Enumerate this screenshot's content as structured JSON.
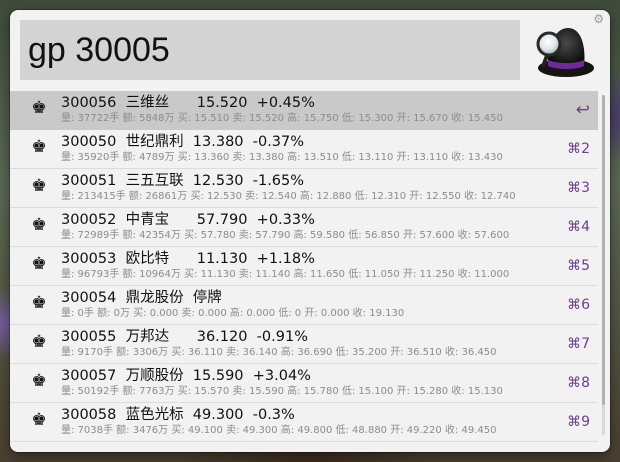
{
  "search": {
    "query": "gp 30005"
  },
  "app": {
    "settings_icon": "gear-icon",
    "logo_icon": "alfred-hat-icon"
  },
  "results": [
    {
      "icon": "chess-king-icon",
      "title": "300056  三维丝      15.520  +0.45%",
      "subtitle": "量: 37722手 额: 5848万 买: 15.510 卖: 15.520 高: 15.750 低: 15.300 开: 15.670 收: 15.450",
      "shortcut": "↩",
      "selected": true
    },
    {
      "icon": "chess-king-icon",
      "title": "300050  世纪鼎利  13.380  -0.37%",
      "subtitle": "量: 35920手 额: 4789万 买: 13.360 卖: 13.380 高: 13.510 低: 13.110 开: 13.110 收: 13.430",
      "shortcut": "⌘2",
      "selected": false
    },
    {
      "icon": "chess-king-icon",
      "title": "300051  三五互联  12.530  -1.65%",
      "subtitle": "量: 213415手 额: 26861万 买: 12.530 卖: 12.540 高: 12.880 低: 12.310 开: 12.550 收: 12.740",
      "shortcut": "⌘3",
      "selected": false
    },
    {
      "icon": "chess-king-icon",
      "title": "300052  中青宝      57.790  +0.33%",
      "subtitle": "量: 72989手 额: 42354万 买: 57.780 卖: 57.790 高: 59.580 低: 56.850 开: 57.600 收: 57.600",
      "shortcut": "⌘4",
      "selected": false
    },
    {
      "icon": "chess-king-icon",
      "title": "300053  欧比特      11.130  +1.18%",
      "subtitle": "量: 96793手 额: 10964万 买: 11.130 卖: 11.140 高: 11.650 低: 11.050 开: 11.250 收: 11.000",
      "shortcut": "⌘5",
      "selected": false
    },
    {
      "icon": "chess-king-icon",
      "title": "300054  鼎龙股份  停牌",
      "subtitle": "量: 0手 额: 0万 买: 0.000 卖: 0.000 高: 0.000 低: 0 开: 0.000 收: 19.130",
      "shortcut": "⌘6",
      "selected": false
    },
    {
      "icon": "chess-king-icon",
      "title": "300055  万邦达      36.120  -0.91%",
      "subtitle": "量: 9170手 额: 3306万 买: 36.110 卖: 36.140 高: 36.690 低: 35.200 开: 36.510 收: 36.450",
      "shortcut": "⌘7",
      "selected": false
    },
    {
      "icon": "chess-king-icon",
      "title": "300057  万顺股份  15.590  +3.04%",
      "subtitle": "量: 50192手 额: 7763万 买: 15.570 卖: 15.590 高: 15.780 低: 15.100 开: 15.280 收: 15.130",
      "shortcut": "⌘8",
      "selected": false
    },
    {
      "icon": "chess-king-icon",
      "title": "300058  蓝色光标  49.300  -0.3%",
      "subtitle": "量: 7038手 额: 3476万 买: 49.100 卖: 49.300 高: 49.800 低: 48.880 开: 49.220 收: 49.450",
      "shortcut": "⌘9",
      "selected": false
    }
  ],
  "colors": {
    "shortcut": "#6b3f8a",
    "selected_row": "#c9c9c9",
    "search_background": "#d3d3d3"
  }
}
